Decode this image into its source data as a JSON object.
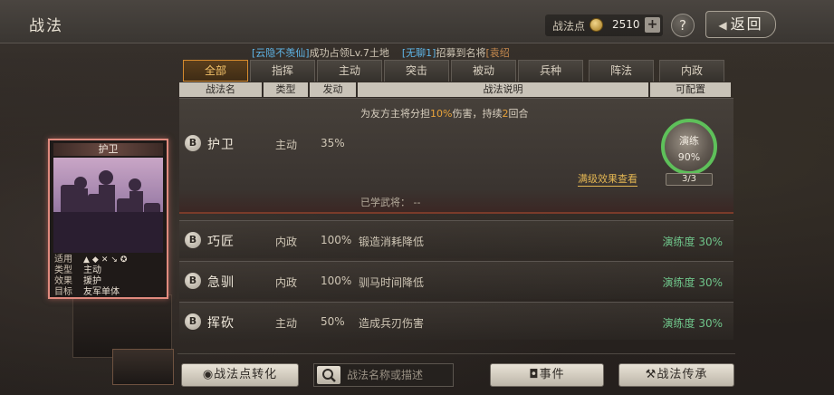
{
  "header": {
    "title": "战法",
    "points_label": "战法点",
    "points_value": "2510",
    "plus": "+",
    "help": "?",
    "back": "返回"
  },
  "ticker": {
    "part1": "[云隐不羡仙]",
    "part2": "成功占领Lv.7土地",
    "part3": "[无聊1]",
    "part4": "招募到名将",
    "part5": "[袁绍"
  },
  "tabs": [
    "全部",
    "指挥",
    "主动",
    "突击",
    "被动",
    "兵种",
    "阵法",
    "内政"
  ],
  "columns": {
    "name": "战法名",
    "type": "类型",
    "trigger": "发动",
    "desc": "战法说明",
    "config": "可配置"
  },
  "selected": {
    "grade": "B",
    "name": "护卫",
    "type": "主动",
    "rate": "35%",
    "desc_pre": "为友方主将分担",
    "desc_hl": "10%",
    "desc_mid": "伤害，持续",
    "desc_hl2": "2",
    "desc_post": "回合",
    "learned": "已学武将：  --",
    "max_effect": "满级效果查看",
    "ring_label": "演练",
    "ring_value": "90%",
    "ring_count": "3/3"
  },
  "rows": [
    {
      "grade": "B",
      "name": "巧匠",
      "type": "内政",
      "rate": "100%",
      "desc": "锻造消耗降低",
      "prof": "演练度 30%"
    },
    {
      "grade": "B",
      "name": "急驯",
      "type": "内政",
      "rate": "100%",
      "desc": "驯马时间降低",
      "prof": "演练度 30%"
    },
    {
      "grade": "B",
      "name": "挥砍",
      "type": "主动",
      "rate": "50%",
      "desc": "造成兵刃伤害",
      "prof": "演练度 30%"
    }
  ],
  "card": {
    "title": "护卫",
    "k1": "适用",
    "k2": "类型",
    "v2": "主动",
    "k3": "效果",
    "v3": "援护",
    "k4": "目标",
    "v4": "友军单体"
  },
  "bottom": {
    "convert": "战法点转化",
    "search_placeholder": "战法名称或描述",
    "events": "事件",
    "inherit": "战法传承"
  }
}
